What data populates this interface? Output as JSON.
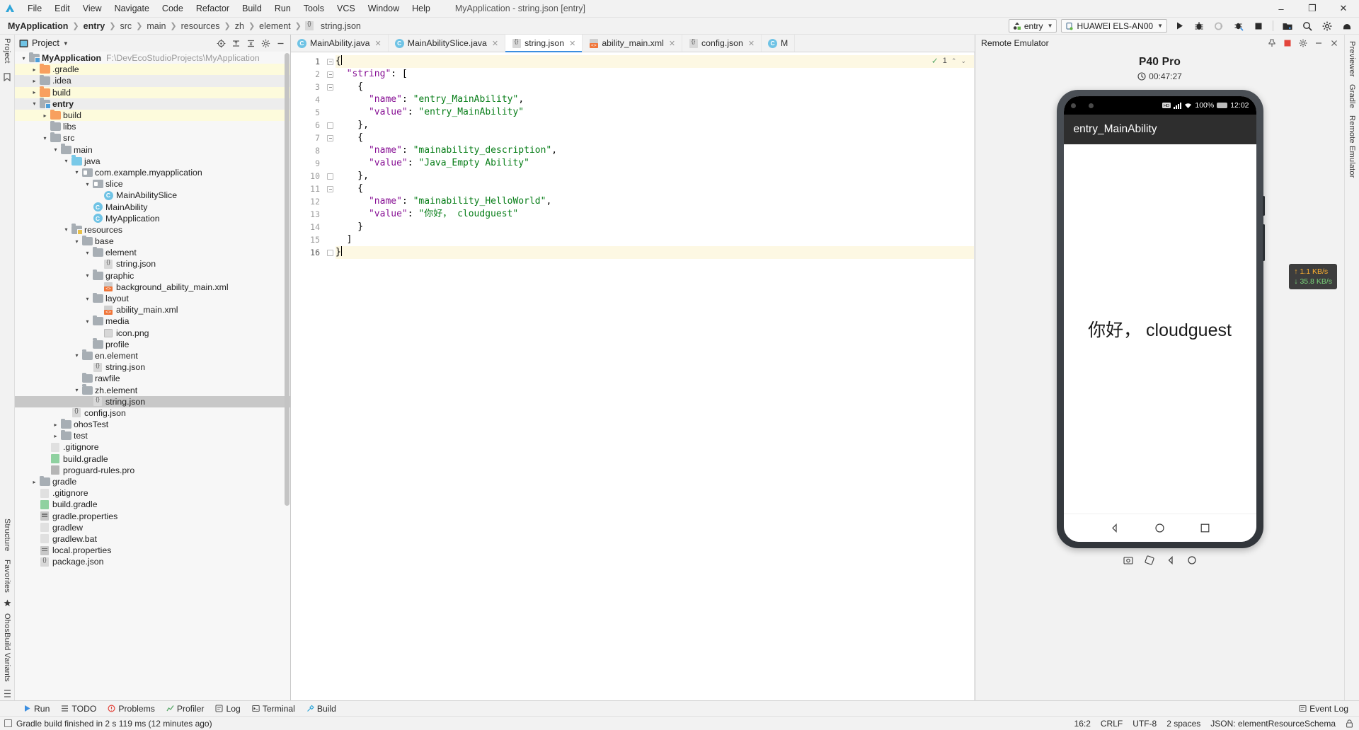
{
  "window": {
    "title": "MyApplication - string.json [entry]",
    "minimize": "–",
    "maximize": "❐",
    "close": "✕"
  },
  "menu": [
    "File",
    "Edit",
    "View",
    "Navigate",
    "Code",
    "Refactor",
    "Build",
    "Run",
    "Tools",
    "VCS",
    "Window",
    "Help"
  ],
  "breadcrumb": [
    "MyApplication",
    "entry",
    "src",
    "main",
    "resources",
    "zh",
    "element",
    "string.json"
  ],
  "toolbar": {
    "run_config": "entry",
    "device": "HUAWEI ELS-AN00",
    "icons": [
      "run-icon",
      "debug-icon",
      "attach-debugger-icon",
      "profile-icon",
      "stop-icon",
      "device-manager-icon",
      "search-everywhere-icon",
      "settings-icon",
      "help-icon"
    ]
  },
  "project_panel": {
    "title": "Project",
    "header_icons": [
      "locate-icon",
      "expand-all-icon",
      "collapse-all-icon",
      "settings-icon",
      "hide-icon"
    ],
    "tree": [
      {
        "depth": 0,
        "twist": "v",
        "icon": "module",
        "label": "MyApplication",
        "bold": true,
        "path": "F:\\DevEcoStudioProjects\\MyApplication",
        "bg": "none"
      },
      {
        "depth": 1,
        "twist": ">",
        "icon": "folder-orange",
        "label": ".gradle",
        "bg": "yel"
      },
      {
        "depth": 1,
        "twist": ">",
        "icon": "folder-gray",
        "label": ".idea",
        "bg": "alt"
      },
      {
        "depth": 1,
        "twist": ">",
        "icon": "folder-orange",
        "label": "build",
        "bg": "yel"
      },
      {
        "depth": 1,
        "twist": "v",
        "icon": "module",
        "label": "entry",
        "bold": true,
        "bg": "alt"
      },
      {
        "depth": 2,
        "twist": ">",
        "icon": "folder-orange",
        "label": "build",
        "bg": "yel"
      },
      {
        "depth": 2,
        "twist": "",
        "icon": "folder-gray",
        "label": "libs",
        "bg": "none"
      },
      {
        "depth": 2,
        "twist": "v",
        "icon": "folder-gray",
        "label": "src",
        "bg": "none"
      },
      {
        "depth": 3,
        "twist": "v",
        "icon": "folder-gray",
        "label": "main",
        "bg": "none"
      },
      {
        "depth": 4,
        "twist": "v",
        "icon": "folder-blue",
        "label": "java",
        "bg": "none"
      },
      {
        "depth": 5,
        "twist": "v",
        "icon": "package",
        "label": "com.example.myapplication",
        "bg": "none"
      },
      {
        "depth": 6,
        "twist": "v",
        "icon": "package",
        "label": "slice",
        "bg": "none"
      },
      {
        "depth": 7,
        "twist": "",
        "icon": "class",
        "label": "MainAbilitySlice",
        "bg": "none"
      },
      {
        "depth": 6,
        "twist": "",
        "icon": "class",
        "label": "MainAbility",
        "bg": "none"
      },
      {
        "depth": 6,
        "twist": "",
        "icon": "class",
        "label": "MyApplication",
        "bg": "none"
      },
      {
        "depth": 4,
        "twist": "v",
        "icon": "resources",
        "label": "resources",
        "bg": "none"
      },
      {
        "depth": 5,
        "twist": "v",
        "icon": "folder-gray",
        "label": "base",
        "bg": "none"
      },
      {
        "depth": 6,
        "twist": "v",
        "icon": "folder-gray",
        "label": "element",
        "bg": "none"
      },
      {
        "depth": 7,
        "twist": "",
        "icon": "json",
        "label": "string.json",
        "bg": "none"
      },
      {
        "depth": 6,
        "twist": "v",
        "icon": "folder-gray",
        "label": "graphic",
        "bg": "none"
      },
      {
        "depth": 7,
        "twist": "",
        "icon": "xml",
        "label": "background_ability_main.xml",
        "bg": "none"
      },
      {
        "depth": 6,
        "twist": "v",
        "icon": "folder-gray",
        "label": "layout",
        "bg": "none"
      },
      {
        "depth": 7,
        "twist": "",
        "icon": "xml",
        "label": "ability_main.xml",
        "bg": "none"
      },
      {
        "depth": 6,
        "twist": "v",
        "icon": "folder-gray",
        "label": "media",
        "bg": "none"
      },
      {
        "depth": 7,
        "twist": "",
        "icon": "png",
        "label": "icon.png",
        "bg": "none"
      },
      {
        "depth": 6,
        "twist": "",
        "icon": "folder-gray",
        "label": "profile",
        "bg": "none"
      },
      {
        "depth": 5,
        "twist": "v",
        "icon": "folder-gray",
        "label": "en.element",
        "bg": "none"
      },
      {
        "depth": 6,
        "twist": "",
        "icon": "json",
        "label": "string.json",
        "bg": "none"
      },
      {
        "depth": 5,
        "twist": "",
        "icon": "folder-gray",
        "label": "rawfile",
        "bg": "none"
      },
      {
        "depth": 5,
        "twist": "v",
        "icon": "folder-gray",
        "label": "zh.element",
        "bg": "none"
      },
      {
        "depth": 6,
        "twist": "",
        "icon": "json",
        "label": "string.json",
        "bg": "sel"
      },
      {
        "depth": 4,
        "twist": "",
        "icon": "json",
        "label": "config.json",
        "bg": "none"
      },
      {
        "depth": 3,
        "twist": ">",
        "icon": "folder-gray",
        "label": "ohosTest",
        "bg": "none"
      },
      {
        "depth": 3,
        "twist": ">",
        "icon": "folder-gray",
        "label": "test",
        "bg": "none"
      },
      {
        "depth": 2,
        "twist": "",
        "icon": "gitignore",
        "label": ".gitignore",
        "bg": "none"
      },
      {
        "depth": 2,
        "twist": "",
        "icon": "gradle",
        "label": "build.gradle",
        "bg": "none"
      },
      {
        "depth": 2,
        "twist": "",
        "icon": "pro",
        "label": "proguard-rules.pro",
        "bg": "none"
      },
      {
        "depth": 1,
        "twist": ">",
        "icon": "folder-gray",
        "label": "gradle",
        "bg": "none"
      },
      {
        "depth": 1,
        "twist": "",
        "icon": "gitignore",
        "label": ".gitignore",
        "bg": "none"
      },
      {
        "depth": 1,
        "twist": "",
        "icon": "gradle",
        "label": "build.gradle",
        "bg": "none"
      },
      {
        "depth": 1,
        "twist": "",
        "icon": "props",
        "label": "gradle.properties",
        "bg": "none"
      },
      {
        "depth": 1,
        "twist": "",
        "icon": "file",
        "label": "gradlew",
        "bg": "none"
      },
      {
        "depth": 1,
        "twist": "",
        "icon": "file",
        "label": "gradlew.bat",
        "bg": "none"
      },
      {
        "depth": 1,
        "twist": "",
        "icon": "props",
        "label": "local.properties",
        "bg": "none"
      },
      {
        "depth": 1,
        "twist": "",
        "icon": "json",
        "label": "package.json",
        "bg": "none"
      }
    ]
  },
  "left_rail": {
    "top": [
      "Project"
    ],
    "bottom": [
      "Structure",
      "Favorites",
      "OhosBuild Variants"
    ]
  },
  "right_rail": [
    "Previewer",
    "Gradle",
    "Remote Emulator"
  ],
  "editor": {
    "tabs": [
      {
        "label": "MainAbility.java",
        "icon": "java-class-icon",
        "active": false,
        "closable": true
      },
      {
        "label": "MainAbilitySlice.java",
        "icon": "java-class-icon",
        "active": false,
        "closable": true
      },
      {
        "label": "string.json",
        "icon": "json-icon",
        "active": true,
        "closable": true
      },
      {
        "label": "ability_main.xml",
        "icon": "xml-icon",
        "active": false,
        "closable": true
      },
      {
        "label": "config.json",
        "icon": "json-icon",
        "active": false,
        "closable": true
      },
      {
        "label": "M",
        "icon": "java-class-icon",
        "active": false,
        "closable": false
      }
    ],
    "inspection": {
      "count": "1",
      "check": "✓",
      "up": "⌃",
      "down": "⌄"
    },
    "lines": [
      {
        "n": "1",
        "fold": "open",
        "hl": true,
        "tokens": [
          {
            "t": "{",
            "c": "p"
          }
        ],
        "caret": true
      },
      {
        "n": "2",
        "fold": "open",
        "hl": false,
        "tokens": [
          {
            "t": "  ",
            "c": "p"
          },
          {
            "t": "\"string\"",
            "c": "k"
          },
          {
            "t": ": [",
            "c": "p"
          }
        ]
      },
      {
        "n": "3",
        "fold": "open",
        "hl": false,
        "tokens": [
          {
            "t": "    {",
            "c": "p"
          }
        ]
      },
      {
        "n": "4",
        "fold": "",
        "hl": false,
        "tokens": [
          {
            "t": "      ",
            "c": "p"
          },
          {
            "t": "\"name\"",
            "c": "k"
          },
          {
            "t": ": ",
            "c": "p"
          },
          {
            "t": "\"entry_MainAbility\"",
            "c": "s"
          },
          {
            "t": ",",
            "c": "p"
          }
        ]
      },
      {
        "n": "5",
        "fold": "",
        "hl": false,
        "tokens": [
          {
            "t": "      ",
            "c": "p"
          },
          {
            "t": "\"value\"",
            "c": "k"
          },
          {
            "t": ": ",
            "c": "p"
          },
          {
            "t": "\"entry_MainAbility\"",
            "c": "s"
          }
        ]
      },
      {
        "n": "6",
        "fold": "close",
        "hl": false,
        "tokens": [
          {
            "t": "    },",
            "c": "p"
          }
        ]
      },
      {
        "n": "7",
        "fold": "open",
        "hl": false,
        "tokens": [
          {
            "t": "    {",
            "c": "p"
          }
        ]
      },
      {
        "n": "8",
        "fold": "",
        "hl": false,
        "tokens": [
          {
            "t": "      ",
            "c": "p"
          },
          {
            "t": "\"name\"",
            "c": "k"
          },
          {
            "t": ": ",
            "c": "p"
          },
          {
            "t": "\"mainability_description\"",
            "c": "s"
          },
          {
            "t": ",",
            "c": "p"
          }
        ]
      },
      {
        "n": "9",
        "fold": "",
        "hl": false,
        "tokens": [
          {
            "t": "      ",
            "c": "p"
          },
          {
            "t": "\"value\"",
            "c": "k"
          },
          {
            "t": ": ",
            "c": "p"
          },
          {
            "t": "\"Java_Empty Ability\"",
            "c": "s"
          }
        ]
      },
      {
        "n": "10",
        "fold": "close",
        "hl": false,
        "tokens": [
          {
            "t": "    },",
            "c": "p"
          }
        ]
      },
      {
        "n": "11",
        "fold": "open",
        "hl": false,
        "tokens": [
          {
            "t": "    {",
            "c": "p"
          }
        ]
      },
      {
        "n": "12",
        "fold": "",
        "hl": false,
        "tokens": [
          {
            "t": "      ",
            "c": "p"
          },
          {
            "t": "\"name\"",
            "c": "k"
          },
          {
            "t": ": ",
            "c": "p"
          },
          {
            "t": "\"mainability_HelloWorld\"",
            "c": "s"
          },
          {
            "t": ",",
            "c": "p"
          }
        ]
      },
      {
        "n": "13",
        "fold": "",
        "hl": false,
        "tokens": [
          {
            "t": "      ",
            "c": "p"
          },
          {
            "t": "\"value\"",
            "c": "k"
          },
          {
            "t": ": ",
            "c": "p"
          },
          {
            "t": "\"你好， cloudguest\"",
            "c": "s"
          }
        ]
      },
      {
        "n": "14",
        "fold": "",
        "hl": false,
        "tokens": [
          {
            "t": "    }",
            "c": "p"
          }
        ]
      },
      {
        "n": "15",
        "fold": "",
        "hl": false,
        "tokens": [
          {
            "t": "  ]",
            "c": "p"
          }
        ]
      },
      {
        "n": "16",
        "fold": "close",
        "hl": true,
        "tokens": [
          {
            "t": "}",
            "c": "p"
          }
        ],
        "caret": true
      }
    ]
  },
  "emulator": {
    "title": "Remote Emulator",
    "header_icons": [
      "pin-icon",
      "stop-icon",
      "settings-icon",
      "minimize-icon",
      "close-icon"
    ],
    "device_name": "P40 Pro",
    "timer": "00:47:27",
    "timer_icon": "clock-icon",
    "status_bar": {
      "battery": "100%",
      "time": "12:02",
      "icons": [
        "hd-icon",
        "signal-icon",
        "wifi-icon"
      ]
    },
    "app_bar_title": "entry_MainAbility",
    "screen_text": "你好， cloudguest",
    "nav_buttons": [
      "back-icon",
      "home-icon",
      "recents-icon"
    ],
    "toast": {
      "up": "↑ 1.1 KB/s",
      "down": "↓ 35.8 KB/s"
    },
    "footer_icons": [
      "screenshot-icon",
      "rotate-icon",
      "back-icon",
      "home-icon"
    ]
  },
  "toolwindows": [
    {
      "label": "Run",
      "icon": "run-icon"
    },
    {
      "label": "TODO",
      "icon": "todo-icon"
    },
    {
      "label": "Problems",
      "icon": "problems-icon"
    },
    {
      "label": "Profiler",
      "icon": "profiler-icon"
    },
    {
      "label": "Log",
      "icon": "log-icon"
    },
    {
      "label": "Terminal",
      "icon": "terminal-icon"
    },
    {
      "label": "Build",
      "icon": "build-icon"
    }
  ],
  "toolwindows_right": {
    "label": "Event Log",
    "icon": "event-log-icon"
  },
  "status_bar": {
    "message": "Gradle build finished in 2 s 119 ms (12 minutes ago)",
    "icon": "info-icon",
    "caret": "16:2",
    "line_sep": "CRLF",
    "encoding": "UTF-8",
    "indent": "2 spaces",
    "schema": "JSON: elementResourceSchema",
    "lock_icon": "lock-icon"
  },
  "colors": {
    "accent": "#3b8ee0",
    "key": "#871094",
    "string": "#067d17",
    "folder_orange": "#f8a05f",
    "highlight_row": "#fdf8e3"
  }
}
